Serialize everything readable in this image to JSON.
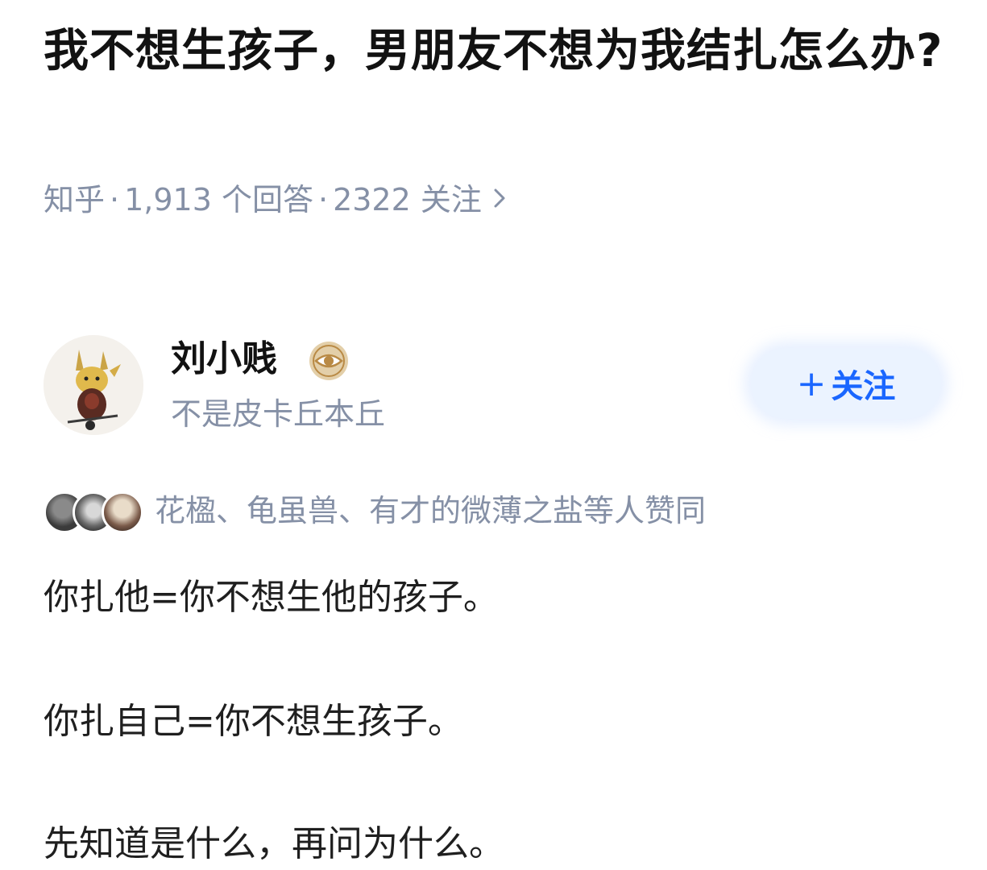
{
  "question": {
    "title": "我不想生孩子，男朋友不想为我结扎怎么办?",
    "meta": {
      "source": "知乎",
      "answers": "1,913 个回答",
      "followers": "2322 关注",
      "chevron_icon": "chevron-right-icon"
    }
  },
  "answer": {
    "author": {
      "name": "刘小贱",
      "bio": "不是皮卡丘本丘",
      "avatar_icon": "pikachu-avatar",
      "badge_icon": "eye-badge-icon"
    },
    "follow_button": {
      "label": "关注",
      "plus": "+",
      "color": "#1a66ff",
      "background": "#ebf3ff"
    },
    "upvoters": {
      "text": "花楹、龟虽兽、有才的微薄之盐等人赞同"
    },
    "paragraphs": [
      "你扎他=你不想生他的孩子。",
      "你扎自己=你不想生孩子。",
      "先知道是什么，再问为什么。"
    ]
  },
  "colors": {
    "title": "#121212",
    "meta": "#8590a6",
    "body": "#1f1f1f"
  }
}
